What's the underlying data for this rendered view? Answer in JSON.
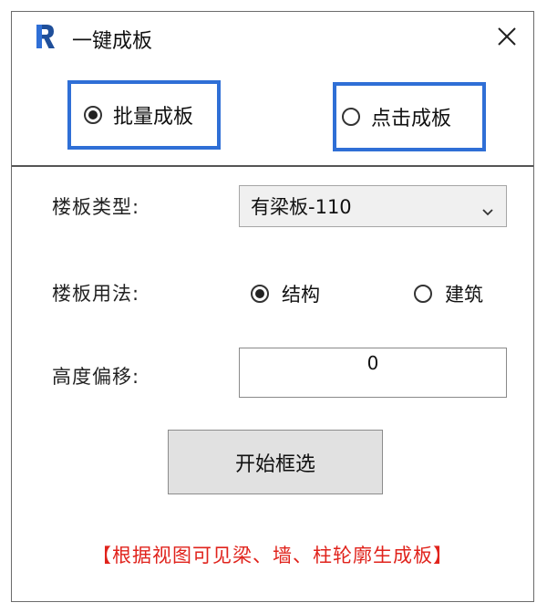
{
  "window": {
    "title": "一键成板",
    "close_icon": "close-icon",
    "app_icon": "revit-logo-icon",
    "brand_color": "#2f6fd6"
  },
  "modes": {
    "batch": {
      "label": "批量成板",
      "selected": true
    },
    "click": {
      "label": "点击成板",
      "selected": false
    }
  },
  "form": {
    "floor_type": {
      "label": "楼板类型:",
      "value": "有梁板-110"
    },
    "usage": {
      "label": "楼板用法:",
      "options": [
        {
          "label": "结构",
          "selected": true
        },
        {
          "label": "建筑",
          "selected": false
        }
      ]
    },
    "offset": {
      "label": "高度偏移:",
      "value": "0"
    }
  },
  "action": {
    "label": "开始框选"
  },
  "note": "【根据视图可见梁、墙、柱轮廓生成板】",
  "colors": {
    "note": "#e0231c",
    "highlight": "#2f6fd6"
  }
}
